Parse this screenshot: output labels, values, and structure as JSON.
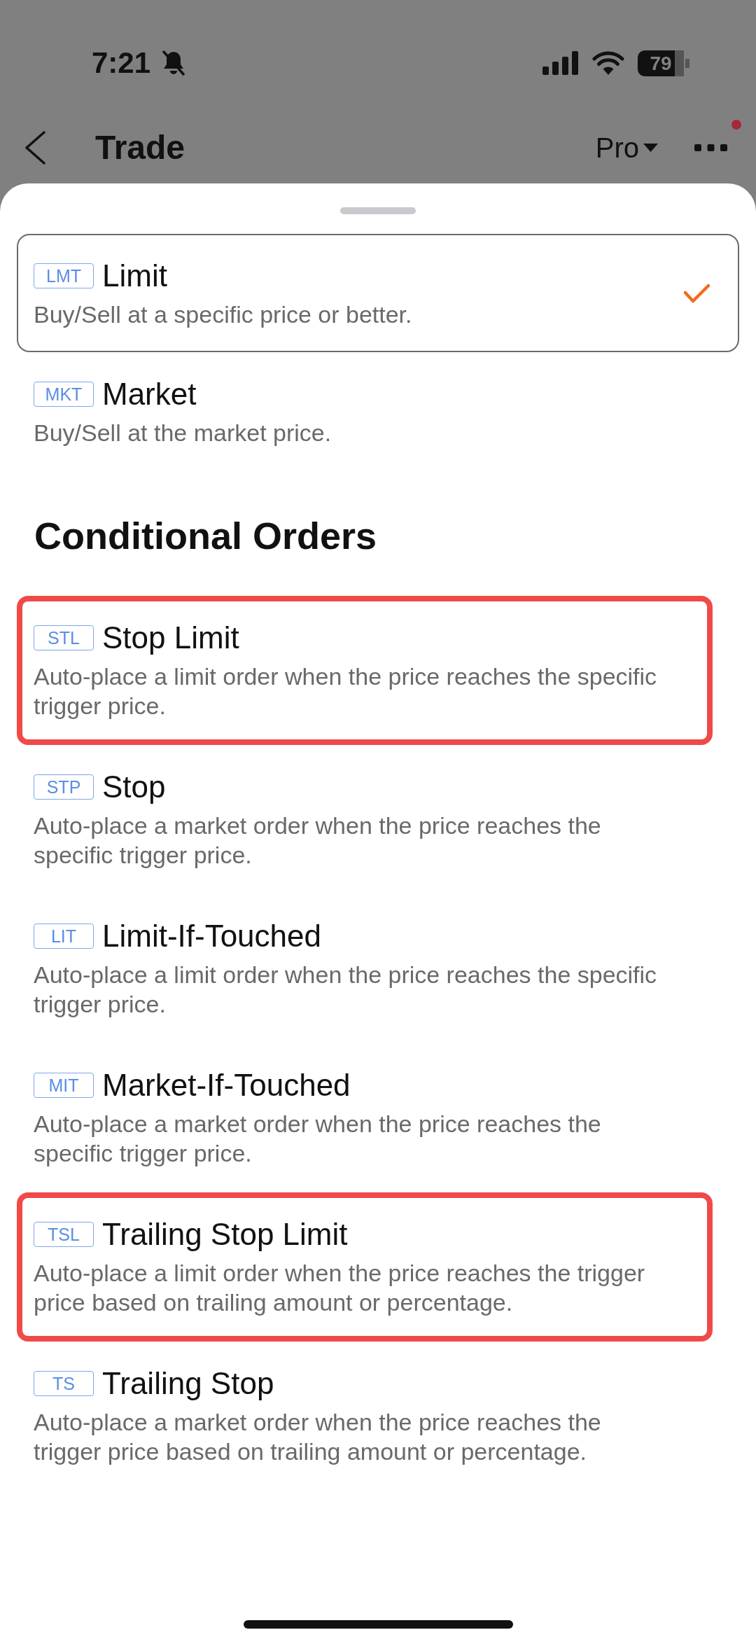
{
  "status_bar": {
    "time": "7:21",
    "battery": "79"
  },
  "header": {
    "title": "Trade",
    "mode_selector": {
      "label": "Pro"
    },
    "more_menu": {
      "has_notification": true
    }
  },
  "sheet": {
    "orders": [
      {
        "code": "LMT",
        "name": "Limit",
        "description": "Buy/Sell at a specific price or better.",
        "selected": true
      },
      {
        "code": "MKT",
        "name": "Market",
        "description": "Buy/Sell at the market price.",
        "selected": false
      }
    ],
    "conditional_orders": {
      "title": "Conditional Orders",
      "items": [
        {
          "code": "STL",
          "name": "Stop Limit",
          "description": "Auto-place a limit order when the price reaches the specific trigger price.",
          "selected": false,
          "highlighted": true
        },
        {
          "code": "STP",
          "name": "Stop",
          "description": "Auto-place a market order when the price reaches the specific trigger price.",
          "selected": false,
          "highlighted": false
        },
        {
          "code": "LIT",
          "name": "Limit-If-Touched",
          "description": "Auto-place a limit order when the price reaches the specific trigger price.",
          "selected": false,
          "highlighted": false
        },
        {
          "code": "MIT",
          "name": "Market-If-Touched",
          "description": "Auto-place a market order when the price reaches the specific trigger price.",
          "selected": false,
          "highlighted": false
        },
        {
          "code": "TSL",
          "name": "Trailing Stop Limit",
          "description": "Auto-place a limit order when the price reaches the trigger price based on trailing amount or percentage.",
          "selected": false,
          "highlighted": true
        },
        {
          "code": "TS",
          "name": "Trailing Stop",
          "description": "Auto-place a market order when the price reaches the trigger price based on trailing amount or percentage.",
          "selected": false,
          "highlighted": false
        }
      ]
    }
  }
}
